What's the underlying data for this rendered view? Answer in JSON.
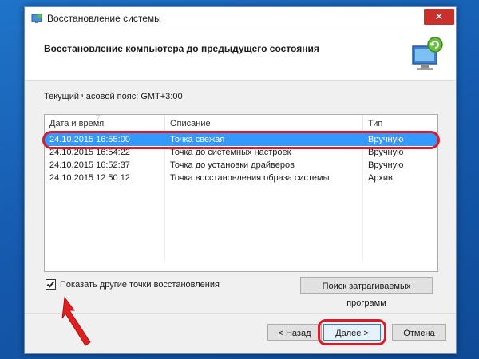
{
  "window": {
    "title": "Восстановление системы",
    "close_label": "✕"
  },
  "header": {
    "title": "Восстановление компьютера до предыдущего состояния"
  },
  "timezone_label": "Текущий часовой пояс: GMT+3:00",
  "table": {
    "columns": [
      "Дата и время",
      "Описание",
      "Тип"
    ],
    "rows": [
      {
        "date": "24.10.2015 16:55:00",
        "description": "Точка свежая",
        "type": "Вручную",
        "selected": true
      },
      {
        "date": "24.10.2015 16:54:22",
        "description": "Точка до системных настроек",
        "type": "Вручную",
        "selected": false
      },
      {
        "date": "24.10.2015 16:52:37",
        "description": "Точка до установки драйверов",
        "type": "Вручную",
        "selected": false
      },
      {
        "date": "24.10.2015 12:50:12",
        "description": "Точка восстановления образа системы",
        "type": "Архив",
        "selected": false
      }
    ]
  },
  "show_more_checkbox": {
    "label": "Показать другие точки восстановления",
    "checked": true
  },
  "buttons": {
    "search": "Поиск затрагиваемых программ",
    "back": "< Назад",
    "next": "Далее >",
    "cancel": "Отмена"
  },
  "colors": {
    "selection": "#3399ff",
    "highlight": "#d81b2a",
    "desktop": "#1a5fb4"
  }
}
